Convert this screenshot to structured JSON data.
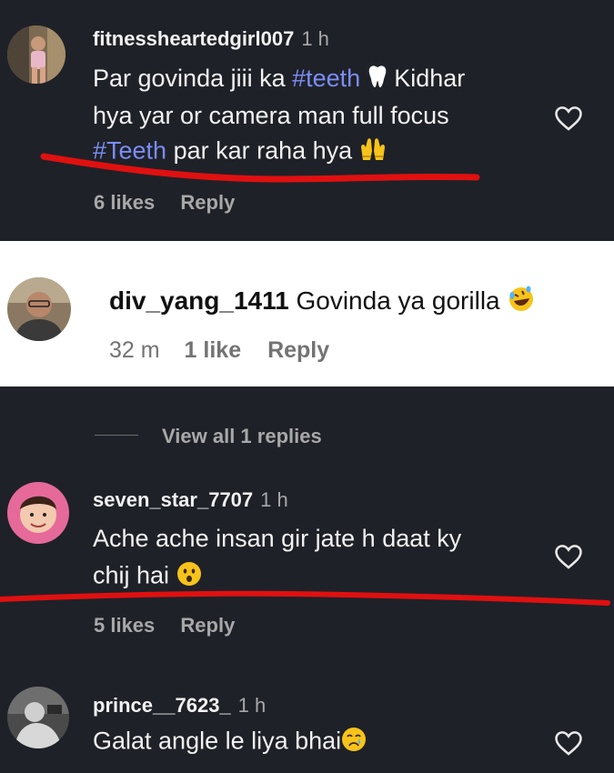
{
  "comment1": {
    "username": "fitnessheartedgirl007",
    "time": "1 h",
    "line1_pre": "Par govinda jiii ka ",
    "line1_tag": "#teeth",
    "line1_post": " Kidhar",
    "line2": "hya yar or camera man full focus",
    "line3_tag": "#Teeth",
    "line3_post": " par kar raha hya",
    "likes": "6 likes",
    "reply": "Reply"
  },
  "comment2": {
    "username": "div_yang_1411",
    "text": "Govinda ya gorilla",
    "time": "32 m",
    "likes": "1 like",
    "reply": "Reply"
  },
  "replies": {
    "label": "View all 1 replies"
  },
  "comment3": {
    "username": "seven_star_7707",
    "time": "1 h",
    "line1": "Ache ache insan gir jate h daat ky",
    "line2": "chij hai",
    "likes": "5 likes",
    "reply": "Reply"
  },
  "comment4": {
    "username": "prince__7623_",
    "time": "1 h",
    "line1": "Galat angle le liya bhai"
  },
  "icons": {
    "heart": "heart-outline-icon",
    "tooth": "tooth-emoji",
    "hands": "raised-hands-emoji",
    "rofl": "rolling-laughing-emoji",
    "hushed": "hushed-face-emoji",
    "crying": "crying-face-emoji"
  },
  "colors": {
    "dark_bg": "#1f2128",
    "hashtag": "#7b8df5",
    "annotation_red": "#e01010"
  }
}
